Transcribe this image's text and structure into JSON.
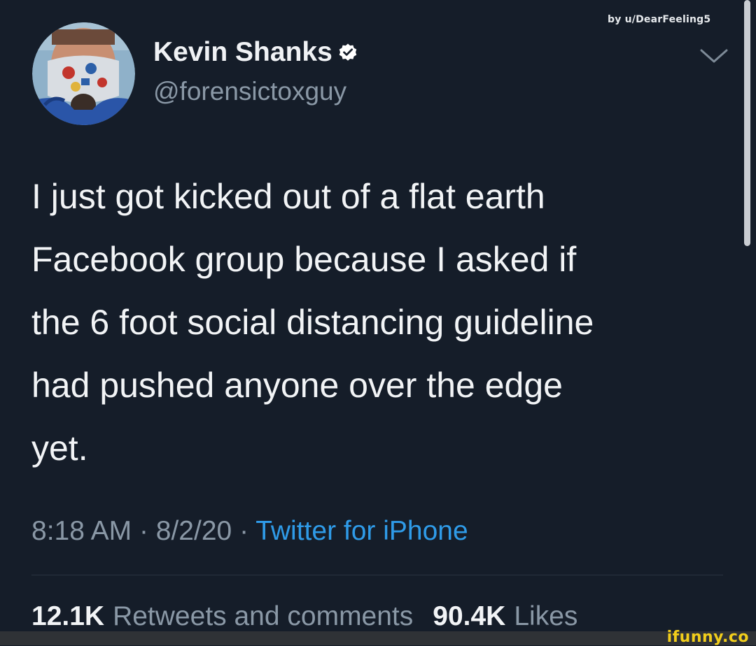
{
  "watermark_top": "by u/DearFeeling5",
  "user": {
    "display_name": "Kevin Shanks",
    "handle": "@forensictoxguy",
    "verified": true
  },
  "icons": {
    "verified": "verified-badge-icon",
    "more": "chevron-down-icon"
  },
  "tweet": {
    "text": "I just got kicked out of a flat earth\nFacebook group because I asked if\nthe 6 foot social distancing guideline\nhad pushed anyone over the edge\nyet.",
    "time": "8:18 AM",
    "date": "8/2/20",
    "separator": "·",
    "source": "Twitter for iPhone"
  },
  "stats": {
    "retweets_count": "12.1K",
    "retweets_label": "Retweets and comments",
    "likes_count": "90.4K",
    "likes_label": "Likes"
  },
  "watermark_bottom": "ifunny.co",
  "colors": {
    "background": "#151d29",
    "link_blue": "#2f9be8",
    "muted_gray": "#8a98a6",
    "ifunny_yellow": "#f2ce1b"
  }
}
